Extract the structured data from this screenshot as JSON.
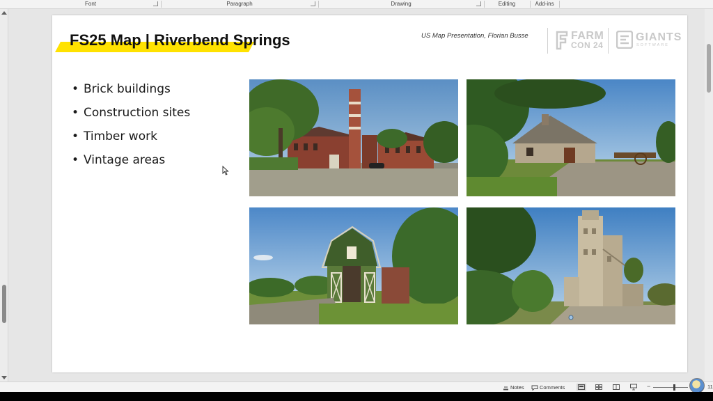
{
  "ribbon": {
    "groups": [
      "Font",
      "Paragraph",
      "Drawing",
      "Editing",
      "Add-ins"
    ]
  },
  "slide": {
    "title": "FS25 Map | Riverbend Springs",
    "subtitle": "US Map Presentation, Florian Busse",
    "logos": {
      "farmcon_line1": "FARM",
      "farmcon_line2": "CON 24",
      "giants_line1": "GIANTS",
      "giants_line2": "SOFTWARE"
    },
    "bullets": [
      "Brick buildings",
      "Construction sites",
      "Timber work",
      "Vintage areas"
    ],
    "photos": [
      {
        "icon": "brick-factory-photo"
      },
      {
        "icon": "stone-barn-photo"
      },
      {
        "icon": "green-barn-photo"
      },
      {
        "icon": "grain-elevator-photo"
      }
    ],
    "highlight_color": "#ffe200"
  },
  "statusbar": {
    "notes_label": "Notes",
    "comments_label": "Comments",
    "zoom_minus": "−",
    "zoom_plus": "+",
    "zoom_value": "11"
  }
}
